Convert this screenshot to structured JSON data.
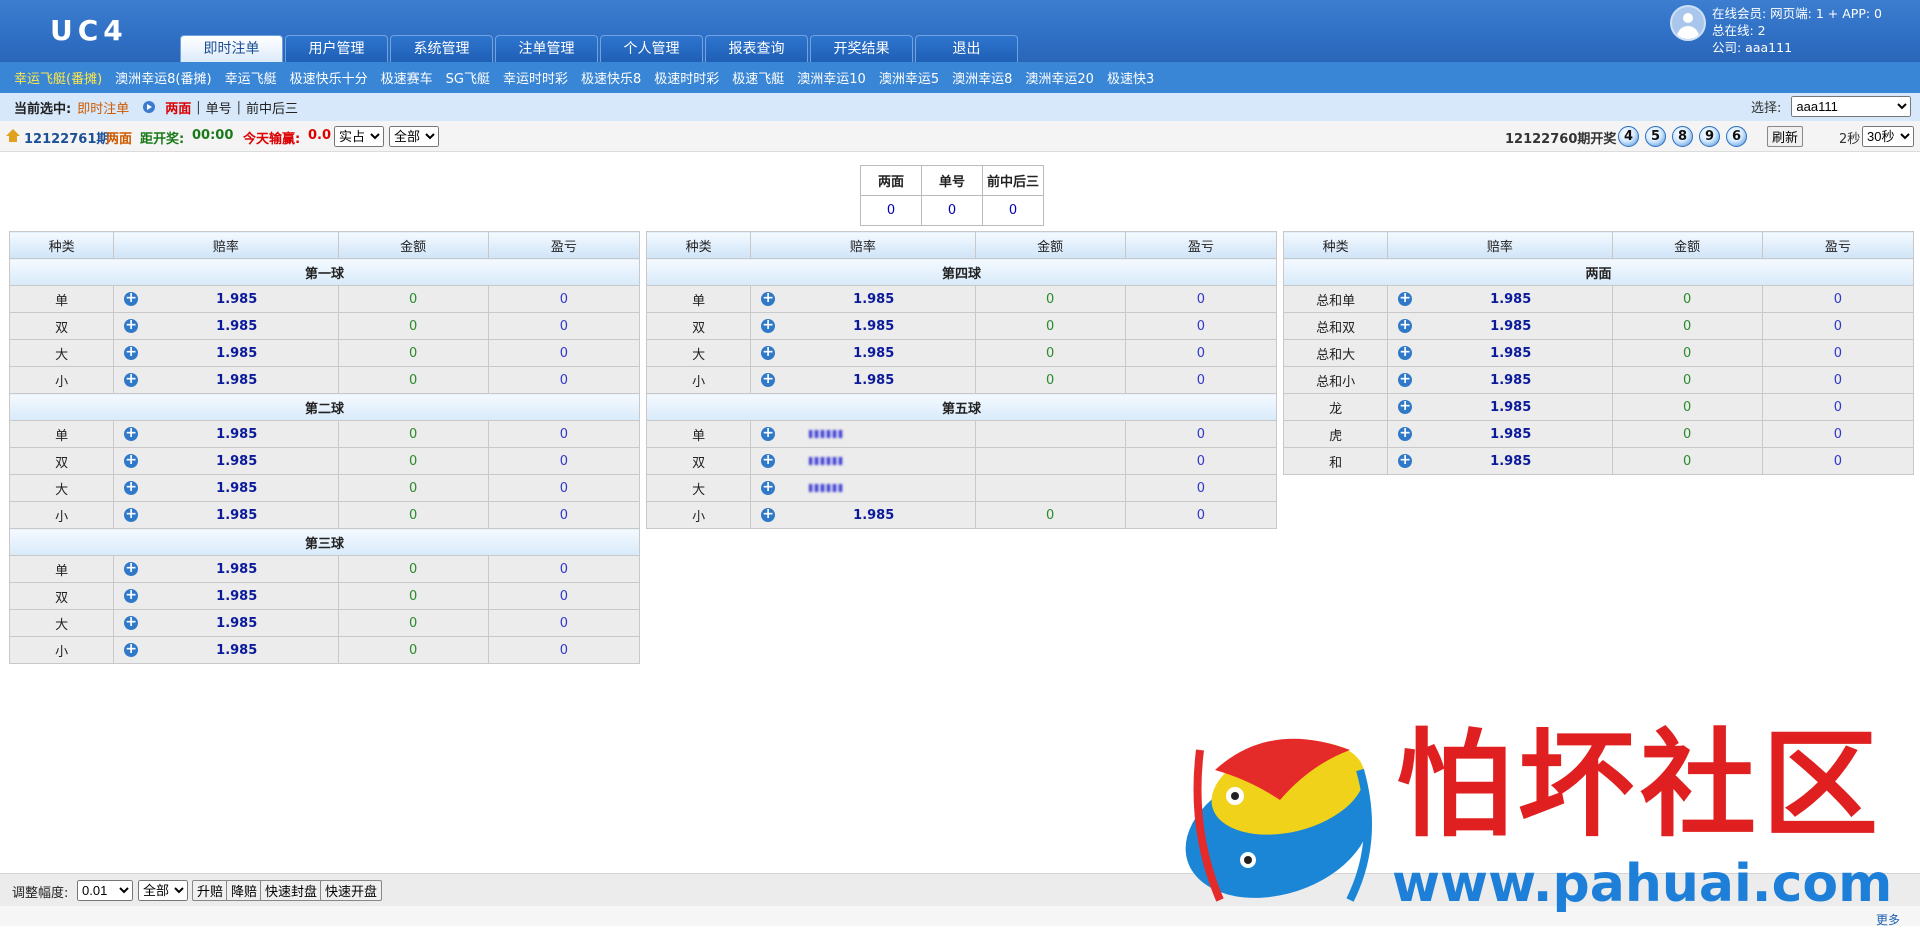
{
  "header": {
    "logo": "UC4",
    "nav": [
      "即时注单",
      "用户管理",
      "系统管理",
      "注单管理",
      "个人管理",
      "报表查询",
      "开奖结果",
      "退出"
    ],
    "user_lines": [
      "在线会员: 网页端: 1 + APP: 0",
      "总在线: 2",
      "公司: aaa111"
    ]
  },
  "games": [
    "幸运飞艇(番摊)",
    "澳洲幸运8(番摊)",
    "幸运飞艇",
    "极速快乐十分",
    "极速赛车",
    "SG飞艇",
    "幸运时时彩",
    "极速快乐8",
    "极速时时彩",
    "极速飞艇",
    "澳洲幸运10",
    "澳洲幸运5",
    "澳洲幸运8",
    "澳洲幸运20",
    "极速快3"
  ],
  "crumb": {
    "label": "当前选中:",
    "current": "即时注单",
    "active_tab": "两面",
    "tabs": [
      "单号",
      "前中后三"
    ],
    "select_label": "选择:",
    "select_value": "aaa111"
  },
  "info": {
    "period": "12122761期",
    "play": "两面",
    "countdown_label": "距开奖:",
    "countdown": "00:00",
    "today_label": "今天输赢:",
    "today_value": "0.0",
    "mode": "实占",
    "scope": "全部",
    "last_period": "12122760期开奖",
    "balls": [
      "4",
      "5",
      "8",
      "9",
      "6"
    ],
    "refresh": "刷新",
    "timer": "2秒",
    "interval": "30秒"
  },
  "summary": {
    "headers": [
      "两面",
      "单号",
      "前中后三"
    ],
    "values": [
      "0",
      "0",
      "0"
    ]
  },
  "columns": [
    "种类",
    "赔率",
    "金额",
    "盈亏"
  ],
  "tables": [
    {
      "sections": [
        {
          "title": "第一球",
          "rows": [
            [
              "单",
              "1.985",
              "0",
              "0"
            ],
            [
              "双",
              "1.985",
              "0",
              "0"
            ],
            [
              "大",
              "1.985",
              "0",
              "0"
            ],
            [
              "小",
              "1.985",
              "0",
              "0"
            ]
          ]
        },
        {
          "title": "第二球",
          "rows": [
            [
              "单",
              "1.985",
              "0",
              "0"
            ],
            [
              "双",
              "1.985",
              "0",
              "0"
            ],
            [
              "大",
              "1.985",
              "0",
              "0"
            ],
            [
              "小",
              "1.985",
              "0",
              "0"
            ]
          ]
        },
        {
          "title": "第三球",
          "rows": [
            [
              "单",
              "1.985",
              "0",
              "0"
            ],
            [
              "双",
              "1.985",
              "0",
              "0"
            ],
            [
              "大",
              "1.985",
              "0",
              "0"
            ],
            [
              "小",
              "1.985",
              "0",
              "0"
            ]
          ]
        }
      ]
    },
    {
      "sections": [
        {
          "title": "第四球",
          "rows": [
            [
              "单",
              "1.985",
              "0",
              "0"
            ],
            [
              "双",
              "1.985",
              "0",
              "0"
            ],
            [
              "大",
              "1.985",
              "0",
              "0"
            ],
            [
              "小",
              "1.985",
              "0",
              "0"
            ]
          ]
        },
        {
          "title": "第五球",
          "rows": [
            [
              "单",
              "",
              "",
              "0"
            ],
            [
              "双",
              "",
              "",
              "0"
            ],
            [
              "大",
              "",
              "",
              "0"
            ],
            [
              "小",
              "1.985",
              "0",
              "0"
            ]
          ]
        }
      ]
    },
    {
      "sections": [
        {
          "title": "两面",
          "rows": [
            [
              "总和单",
              "1.985",
              "0",
              "0"
            ],
            [
              "总和双",
              "1.985",
              "0",
              "0"
            ],
            [
              "总和大",
              "1.985",
              "0",
              "0"
            ],
            [
              "总和小",
              "1.985",
              "0",
              "0"
            ],
            [
              "龙",
              "1.985",
              "0",
              "0"
            ],
            [
              "虎",
              "1.985",
              "0",
              "0"
            ],
            [
              "和",
              "1.985",
              "0",
              "0"
            ]
          ]
        }
      ]
    }
  ],
  "footer": {
    "label": "调整幅度:",
    "step": "0.01",
    "scope": "全部",
    "buttons": [
      "升赔",
      "降赔",
      "快速封盘",
      "快速开盘"
    ],
    "more": "更多"
  },
  "watermark": {
    "text": "怕坏社区",
    "url": "www.pahuai.com"
  },
  "colors": {
    "header_bg": "#2f6fc4",
    "nav_bar": "#3a86d6",
    "active_game": "#ffe84a",
    "odds_text": "#0a1a9a",
    "amount_text": "#2b8a2b",
    "watermark_red": "#e02020",
    "watermark_blue": "#1e7fd8"
  }
}
